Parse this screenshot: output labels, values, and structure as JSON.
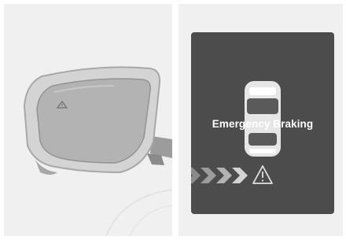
{
  "right_panel": {
    "display_text": "Emergency Braking",
    "display_background": "#4c4c4c"
  },
  "icons": {
    "mirror": "side-mirror-icon",
    "indicator": "blind-spot-indicator-icon",
    "car": "car-top-view-icon",
    "arrows": "approaching-chevrons-icon",
    "warning": "warning-triangle-icon"
  }
}
